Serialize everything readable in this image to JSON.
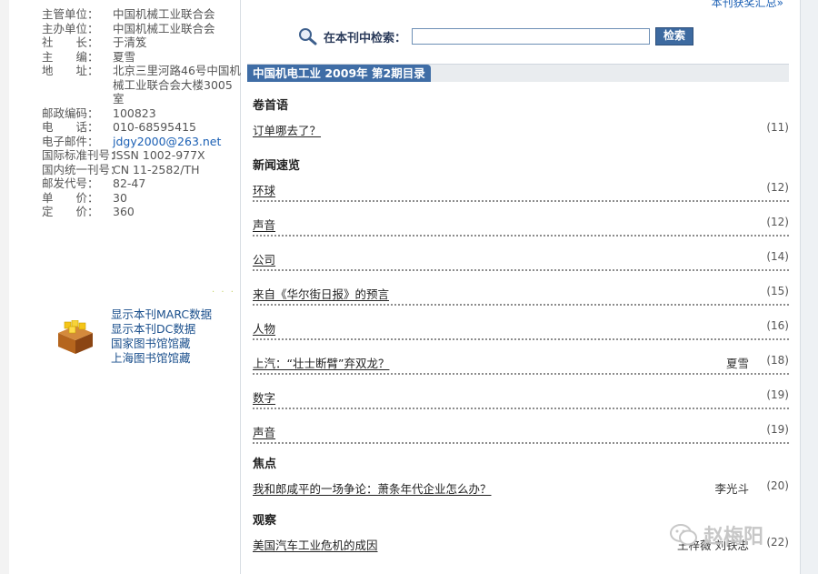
{
  "sidebar": {
    "info": [
      {
        "label": "主管单位：",
        "value": "中国机械工业联合会"
      },
      {
        "label": "主办单位：",
        "value": "中国机械工业联合会"
      },
      {
        "label": "社　　长：",
        "value": "于清笈"
      },
      {
        "label": "主　　编：",
        "value": "夏雪"
      },
      {
        "label": "地　　址：",
        "value": "北京三里河路46号中国机械工业联合会大楼3005室"
      },
      {
        "label": "邮政编码：",
        "value": "100823"
      },
      {
        "label": "电　　话：",
        "value": "010-68595415"
      },
      {
        "label": "电子邮件：",
        "value": "jdgy2000@263.net"
      },
      {
        "label": "国际标准刊号：",
        "value": "ISSN 1002-977X"
      },
      {
        "label": "国内统一刊号：",
        "value": "CN 11-2582/TH"
      },
      {
        "label": "邮发代号：",
        "value": "82-47"
      },
      {
        "label": "单　　价：",
        "value": "30"
      },
      {
        "label": "定　　价：",
        "value": "360"
      }
    ],
    "resource_links": [
      "显示本刊MARC数据",
      "显示本刊DC数据",
      "国家图书馆馆藏",
      "上海图书馆馆藏"
    ]
  },
  "main": {
    "top_link": "本刊获奖汇总»",
    "search": {
      "label": "在本刊中检索：",
      "value": "",
      "button": "检索"
    },
    "issue_title": "中国机电工业 2009年 第2期目录",
    "sections": [
      {
        "title": "卷首语",
        "items": [
          {
            "title": "订单哪去了？",
            "author": "",
            "page": "(11)"
          }
        ]
      },
      {
        "title": "新闻速览",
        "items": [
          {
            "title": "环球",
            "author": "",
            "page": "(12)"
          },
          {
            "title": "声音",
            "author": "",
            "page": "(12)"
          },
          {
            "title": "公司",
            "author": "",
            "page": "(14)"
          },
          {
            "title": "来自《华尔街日报》的预言",
            "author": "",
            "page": "(15)"
          },
          {
            "title": "人物",
            "author": "",
            "page": "(16)"
          },
          {
            "title": "上汽：“壮士断臂”弃双龙？",
            "author": "夏雪",
            "page": "(18)"
          },
          {
            "title": "数字",
            "author": "",
            "page": "(19)"
          },
          {
            "title": "声音",
            "author": "",
            "page": "(19)"
          }
        ]
      },
      {
        "title": "焦点",
        "items": [
          {
            "title": "我和郎咸平的一场争论：萧条年代企业怎么办？",
            "author": "李光斗",
            "page": "(20)"
          }
        ]
      },
      {
        "title": "观察",
        "items": [
          {
            "title": "美国汽车工业危机的成因",
            "author": "王梓薇 刘铁忠",
            "page": "(22)"
          }
        ]
      }
    ]
  },
  "watermark": "赵梅阳",
  "colors": {
    "accent": "#3f6da6",
    "link": "#1a4f8c",
    "bar_bg": "#e9ecef"
  }
}
